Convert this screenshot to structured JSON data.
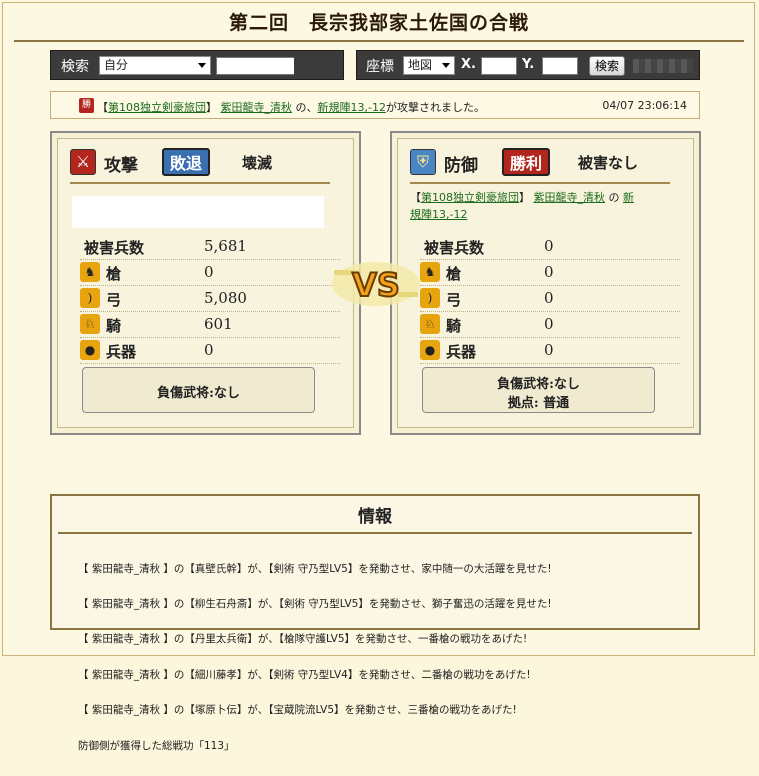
{
  "page": {
    "title": "第二回　長宗我部家土佐国の合戦"
  },
  "search": {
    "label": "検索",
    "scope_value": "自分",
    "button": "検索"
  },
  "coords": {
    "label": "座標",
    "map_value": "地図",
    "x_label": "X.",
    "y_label": "Y.",
    "button": "検索"
  },
  "notice": {
    "icon_text": "勝",
    "prefix": "【",
    "unit_link": "第108独立剣豪旅団",
    "mid": "】",
    "player_link": "紫田龍寺_清秋",
    "text1": " の、",
    "target_link": "新規陣13,-12",
    "text2": "が攻撃されました。",
    "time": "04/07 23:06:14"
  },
  "attack": {
    "role_label": "攻撃",
    "result": "敗退",
    "outcome": "壊滅",
    "stats_header": "被害兵数",
    "total": "5,681",
    "stats": [
      {
        "name": "槍",
        "value": "0"
      },
      {
        "name": "弓",
        "value": "5,080"
      },
      {
        "name": "騎",
        "value": "601"
      },
      {
        "name": "兵器",
        "value": "0"
      }
    ],
    "injured": "負傷武将:なし"
  },
  "defense": {
    "role_label": "防御",
    "result": "勝利",
    "outcome": "被害なし",
    "info_prefix": "【",
    "unit_link": "第108独立剣豪旅団",
    "info_mid": "】",
    "player_link": "紫田龍寺_清秋",
    "info_no": " の ",
    "target_link_a": "新",
    "target_link_b": "規陣13,-12",
    "stats_header": "被害兵数",
    "total": "0",
    "stats": [
      {
        "name": "槍",
        "value": "0"
      },
      {
        "name": "弓",
        "value": "0"
      },
      {
        "name": "騎",
        "value": "0"
      },
      {
        "name": "兵器",
        "value": "0"
      }
    ],
    "injured": "負傷武将:なし",
    "base": "拠点: 普通"
  },
  "vs_text": "VS",
  "info": {
    "title": "情報",
    "lines": [
      "【 紫田龍寺_清秋 】の【真壁氏幹】が、【剣術 守乃型LV5】を発動させ、家中随一の大活躍を見せた!",
      "【 紫田龍寺_清秋 】の【柳生石舟斎】が、【剣術 守乃型LV5】を発動させ、獅子奮迅の活躍を見せた!",
      "【 紫田龍寺_清秋 】の【丹里太兵衛】が、【槍隊守護LV5】を発動させ、一番槍の戦功をあげた!",
      "【 紫田龍寺_清秋 】の【細川藤孝】が、【剣術 守乃型LV4】を発動させ、二番槍の戦功をあげた!",
      "【 紫田龍寺_清秋 】の【塚原卜伝】が、【宝蔵院流LV5】を発動させ、三番槍の戦功をあげた!",
      "防御側が獲得した総戦功「113」"
    ]
  },
  "colors": {
    "defeat_badge": "#3a6fb0",
    "victory_badge": "#b3261e",
    "link": "#1d6b1d"
  }
}
